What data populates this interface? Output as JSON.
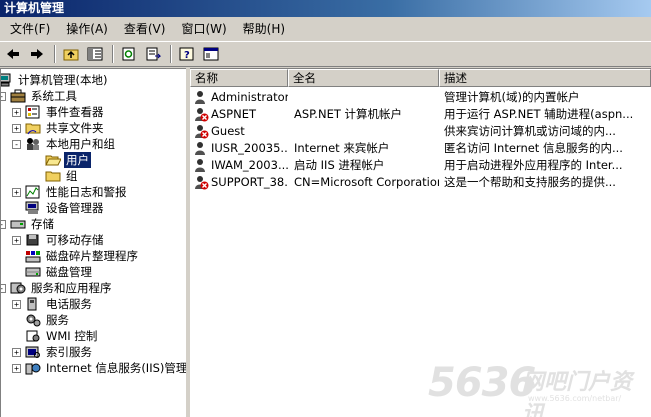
{
  "window": {
    "title": "计算机管理"
  },
  "menu": [
    {
      "label": "文件(F)"
    },
    {
      "label": "操作(A)"
    },
    {
      "label": "查看(V)"
    },
    {
      "label": "窗口(W)"
    },
    {
      "label": "帮助(H)"
    }
  ],
  "toolbar": {
    "buttons": [
      "back-icon",
      "forward-icon",
      "up-folder-icon",
      "show-hide-tree-icon",
      "properties-icon",
      "export-list-icon",
      "help-icon",
      "console-icon"
    ]
  },
  "tree": {
    "root": "计算机管理(本地)",
    "items": [
      {
        "label": "系统工具",
        "expander": "-"
      },
      {
        "label": "事件查看器",
        "expander": "+"
      },
      {
        "label": "共享文件夹",
        "expander": "+"
      },
      {
        "label": "本地用户和组",
        "expander": "-"
      },
      {
        "label": "用户",
        "expander": ""
      },
      {
        "label": "组",
        "expander": ""
      },
      {
        "label": "性能日志和警报",
        "expander": "+"
      },
      {
        "label": "设备管理器",
        "expander": ""
      },
      {
        "label": "存储",
        "expander": "-"
      },
      {
        "label": "可移动存储",
        "expander": "+"
      },
      {
        "label": "磁盘碎片整理程序",
        "expander": ""
      },
      {
        "label": "磁盘管理",
        "expander": ""
      },
      {
        "label": "服务和应用程序",
        "expander": "-"
      },
      {
        "label": "电话服务",
        "expander": "+"
      },
      {
        "label": "服务",
        "expander": ""
      },
      {
        "label": "WMI 控制",
        "expander": ""
      },
      {
        "label": "索引服务",
        "expander": "+"
      },
      {
        "label": "Internet 信息服务(IIS)管理",
        "expander": "+"
      }
    ]
  },
  "list": {
    "columns": [
      "名称",
      "全名",
      "描述"
    ],
    "rows": [
      {
        "name": "Administrator",
        "fullname": "",
        "desc": "管理计算机(域)的内置帐户",
        "disabled": false
      },
      {
        "name": "ASPNET",
        "fullname": "ASP.NET 计算机帐户",
        "desc": "用于运行 ASP.NET 辅助进程(aspn...",
        "disabled": true
      },
      {
        "name": "Guest",
        "fullname": "",
        "desc": "供来宾访问计算机或访问域的内...",
        "disabled": true
      },
      {
        "name": "IUSR_20035...",
        "fullname": "Internet 来宾帐户",
        "desc": "匿名访问 Internet 信息服务的内...",
        "disabled": false
      },
      {
        "name": "IWAM_2003...",
        "fullname": "启动 IIS 进程帐户",
        "desc": "用于启动进程外应用程序的 Inter...",
        "disabled": false
      },
      {
        "name": "SUPPORT_38...",
        "fullname": "CN=Microsoft Corporation....",
        "desc": "这是一个帮助和支持服务的提供...",
        "disabled": true
      }
    ]
  },
  "watermark": {
    "brand": "5636",
    "cn": "网吧门户资讯",
    "url": "www.5636.com/netbar/"
  }
}
